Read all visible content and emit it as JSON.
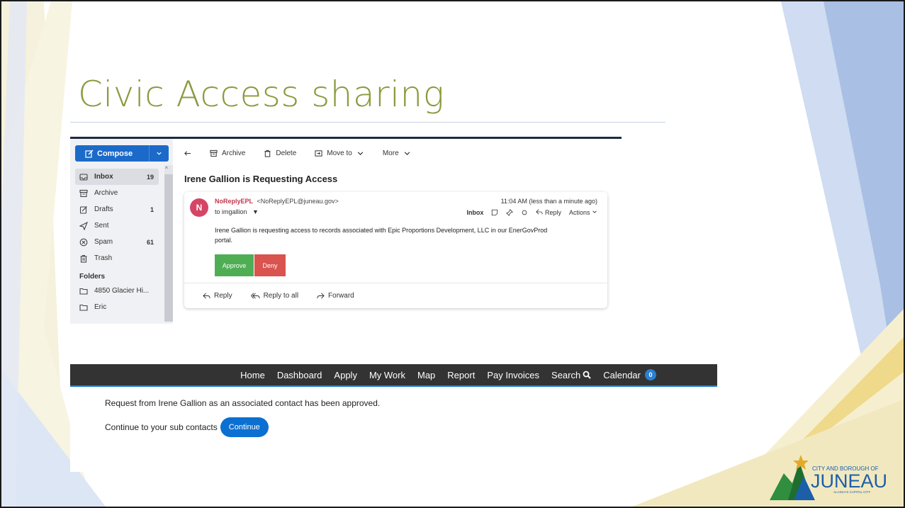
{
  "slide": {
    "title": "Civic Access sharing"
  },
  "mail": {
    "sidebar": {
      "compose_label": "Compose",
      "folders": [
        {
          "label": "Inbox",
          "count": "19",
          "icon": "inbox-icon",
          "active": true
        },
        {
          "label": "Archive",
          "count": "",
          "icon": "archive-icon"
        },
        {
          "label": "Drafts",
          "count": "1",
          "icon": "drafts-icon"
        },
        {
          "label": "Sent",
          "count": "",
          "icon": "sent-icon"
        },
        {
          "label": "Spam",
          "count": "61",
          "icon": "spam-icon"
        },
        {
          "label": "Trash",
          "count": "",
          "icon": "trash-icon"
        }
      ],
      "folders_heading": "Folders",
      "custom_folders": [
        {
          "label": "4850 Glacier Hi..."
        },
        {
          "label": "Eric"
        }
      ]
    },
    "toolbar": {
      "archive": "Archive",
      "delete": "Delete",
      "move_to": "Move to",
      "more": "More"
    },
    "subject": "Irene Gallion is Requesting Access",
    "message": {
      "avatar_letter": "N",
      "sender_name": "NoReplyEPL",
      "sender_email": "<NoReplyEPL@juneau.gov>",
      "to": "to imgallion",
      "time": "11:04 AM (less than a minute ago)",
      "inbox_tag": "Inbox",
      "reply": "Reply",
      "actions": "Actions",
      "body": "Irene Gallion is requesting access to records associated with Epic Proportions Development, LLC in our EnerGovProd portal.",
      "approve": "Approve",
      "deny": "Deny"
    },
    "footer": {
      "reply": "Reply",
      "reply_all": "Reply to all",
      "forward": "Forward"
    }
  },
  "portal": {
    "nav": {
      "home": "Home",
      "dashboard": "Dashboard",
      "apply": "Apply",
      "my_work": "My Work",
      "map": "Map",
      "report": "Report",
      "pay_invoices": "Pay Invoices",
      "search": "Search",
      "calendar": "Calendar",
      "calendar_count": "0"
    },
    "approved_message": "Request from Irene Gallion as an associated contact has been approved.",
    "continue_prompt": "Continue to your sub contacts",
    "continue_button": "Continue"
  },
  "logo": {
    "line1": "CITY AND BOROUGH OF",
    "line2": "JUNEAU",
    "line3": "ALASKA'S CAPITAL CITY"
  },
  "colors": {
    "title": "#8a9a3c",
    "compose": "#1b6ac9",
    "approve": "#4fae54",
    "deny": "#d9534f",
    "nav_bg": "#333333",
    "accent_blue": "#0b70d1"
  }
}
